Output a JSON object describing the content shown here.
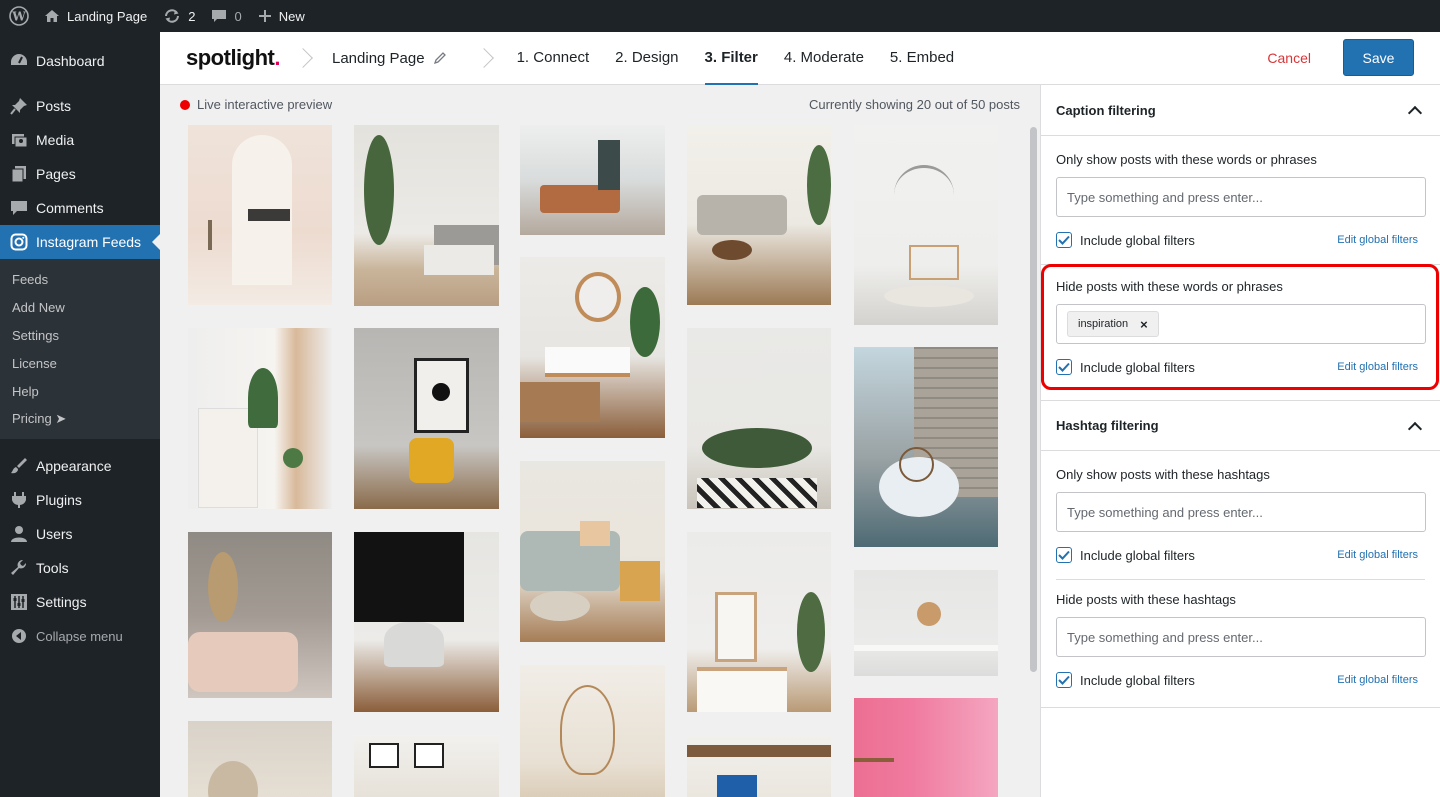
{
  "adminbar": {
    "site_name": "Landing Page",
    "updates_count": "2",
    "comments_count": "0",
    "new_label": "New"
  },
  "sidebar": {
    "items_top": [
      {
        "label": "Dashboard",
        "icon": "dashboard-icon"
      },
      {
        "label": "Posts",
        "icon": "pin-icon"
      },
      {
        "label": "Media",
        "icon": "media-icon"
      },
      {
        "label": "Pages",
        "icon": "pages-icon"
      },
      {
        "label": "Comments",
        "icon": "comment-icon"
      },
      {
        "label": "Instagram Feeds",
        "icon": "instagram-icon"
      }
    ],
    "submenu": [
      "Feeds",
      "Add New",
      "Settings",
      "License",
      "Help",
      "Pricing ➤"
    ],
    "items_bottom": [
      {
        "label": "Appearance",
        "icon": "brush-icon"
      },
      {
        "label": "Plugins",
        "icon": "plugin-icon"
      },
      {
        "label": "Users",
        "icon": "user-icon"
      },
      {
        "label": "Tools",
        "icon": "wrench-icon"
      },
      {
        "label": "Settings",
        "icon": "sliders-icon"
      }
    ],
    "collapse_label": "Collapse menu"
  },
  "header": {
    "logo_text": "spotlight",
    "logo_dot": ".",
    "feed_name": "Landing Page",
    "steps": [
      "1. Connect",
      "2. Design",
      "3. Filter",
      "4. Moderate",
      "5. Embed"
    ],
    "active_step": "3. Filter",
    "cancel_label": "Cancel",
    "save_label": "Save",
    "accent_color": "#2271b1"
  },
  "preview": {
    "live_label": "Live interactive preview",
    "showing_label": "Currently showing 20 out of 50 posts"
  },
  "panel": {
    "caption": {
      "title": "Caption filtering",
      "show_label": "Only show posts with these words or phrases",
      "show_placeholder": "Type something and press enter...",
      "hide_label": "Hide posts with these words or phrases",
      "hide_tags": [
        "inspiration"
      ],
      "include_global": "Include global filters",
      "edit_global": "Edit global filters"
    },
    "hashtag": {
      "title": "Hashtag filtering",
      "show_label": "Only show posts with these hashtags",
      "show_placeholder": "Type something and press enter...",
      "hide_label": "Hide posts with these hashtags",
      "hide_placeholder": "Type something and press enter...",
      "include_global": "Include global filters",
      "edit_global": "Edit global filters"
    }
  }
}
